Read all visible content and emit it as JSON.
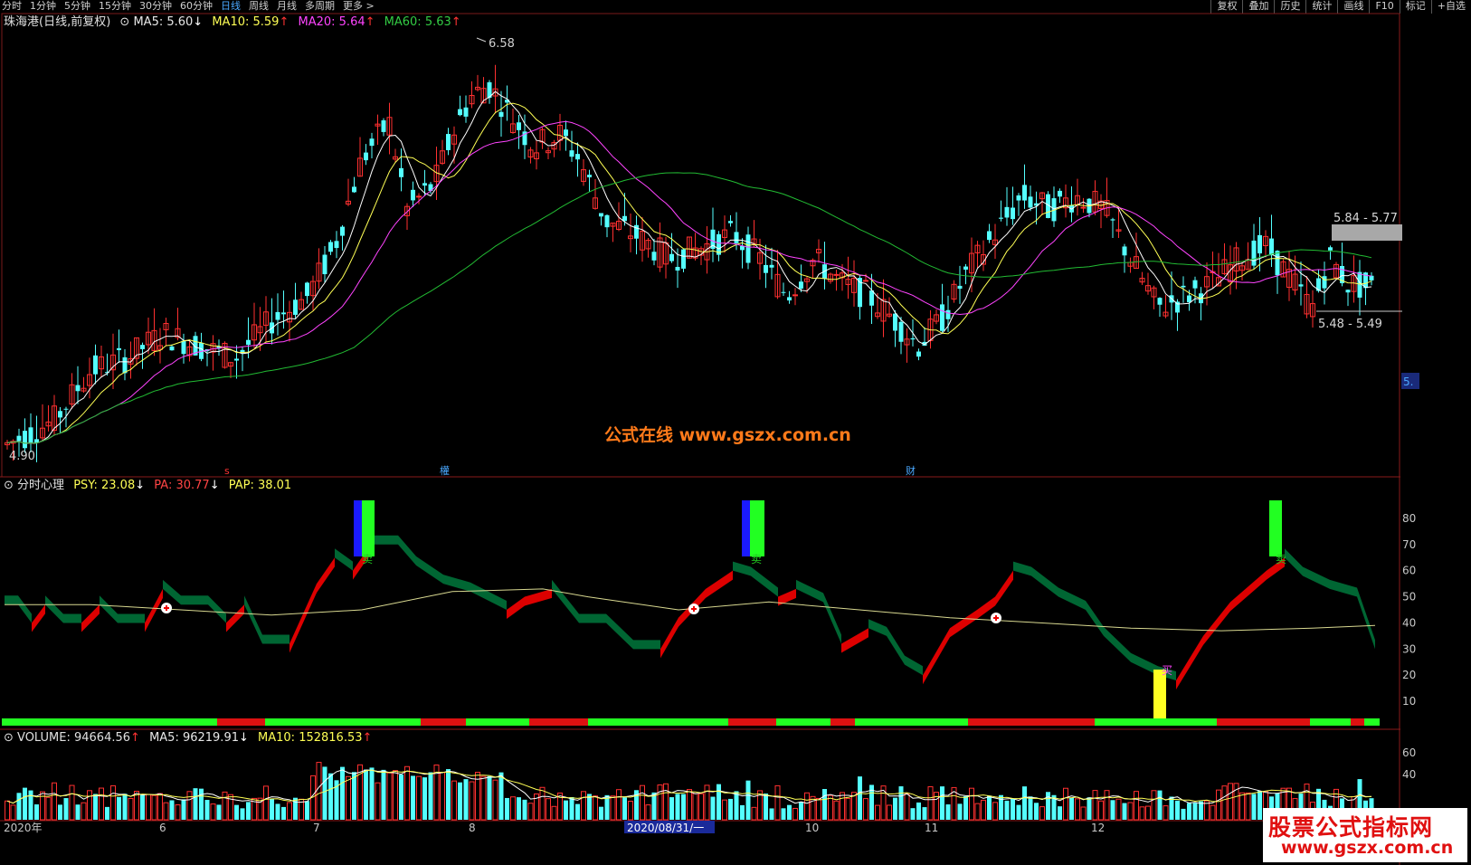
{
  "toolbar": {
    "periods": [
      "分时",
      "1分钟",
      "5分钟",
      "15分钟",
      "30分钟",
      "60分钟",
      "日线",
      "周线",
      "月线",
      "多周期",
      "更多 >"
    ],
    "active": "日线",
    "tools": [
      "复权",
      "叠加",
      "历史",
      "统计",
      "画线",
      "F10",
      "标记",
      "+自选"
    ]
  },
  "main_header": {
    "title": "珠海港(日线,前复权)",
    "ma5": "MA5: 5.60",
    "ma5_dir": "↓",
    "ma10": "MA10: 5.59",
    "ma10_dir": "↑",
    "ma20": "MA20: 5.64",
    "ma20_dir": "↑",
    "ma60": "MA60: 5.63",
    "ma60_dir": "↑"
  },
  "price_labels": {
    "high": "6.58",
    "low": "4.90",
    "range_high": "5.84 - 5.77",
    "range_low": "5.48 - 5.49",
    "axis_tag": "5."
  },
  "event_marks": {
    "s": "s",
    "dividend": "權",
    "finance": "财"
  },
  "watermark_center": "公式在线  www.gszx.com.cn",
  "psy_header": {
    "title": "分时心理",
    "psy": "PSY: 23.08",
    "psy_dir": "↓",
    "pa": "PA: 30.77",
    "pa_dir": "↓",
    "pap": "PAP: 38.01"
  },
  "psy_axis": [
    "80",
    "70",
    "60",
    "50",
    "40",
    "30",
    "20",
    "10"
  ],
  "psy_marks": {
    "sell": "卖",
    "buy": "买"
  },
  "vol_header": {
    "title": "VOLUME: 94664.56",
    "title_dir": "↑",
    "ma5": "MA5: 96219.91",
    "ma5_dir": "↓",
    "ma10": "MA10: 152816.53",
    "ma10_dir": "↑"
  },
  "vol_axis": [
    "60",
    "40"
  ],
  "date_axis": [
    "2020年",
    "6",
    "7",
    "8",
    "2020/08/31/一",
    "10",
    "11",
    "12"
  ],
  "corner_watermark": {
    "line1": "股票公式指标网",
    "line2": "www.gszx.com.cn"
  },
  "colors": {
    "up": "#ff3030",
    "down": "#54ffff",
    "ma5": "#ffffff",
    "ma10": "#ffff55",
    "ma20": "#ff44ff",
    "ma60": "#22bb33",
    "psy_up": "#dd0000",
    "psy_dn": "#006633"
  }
}
